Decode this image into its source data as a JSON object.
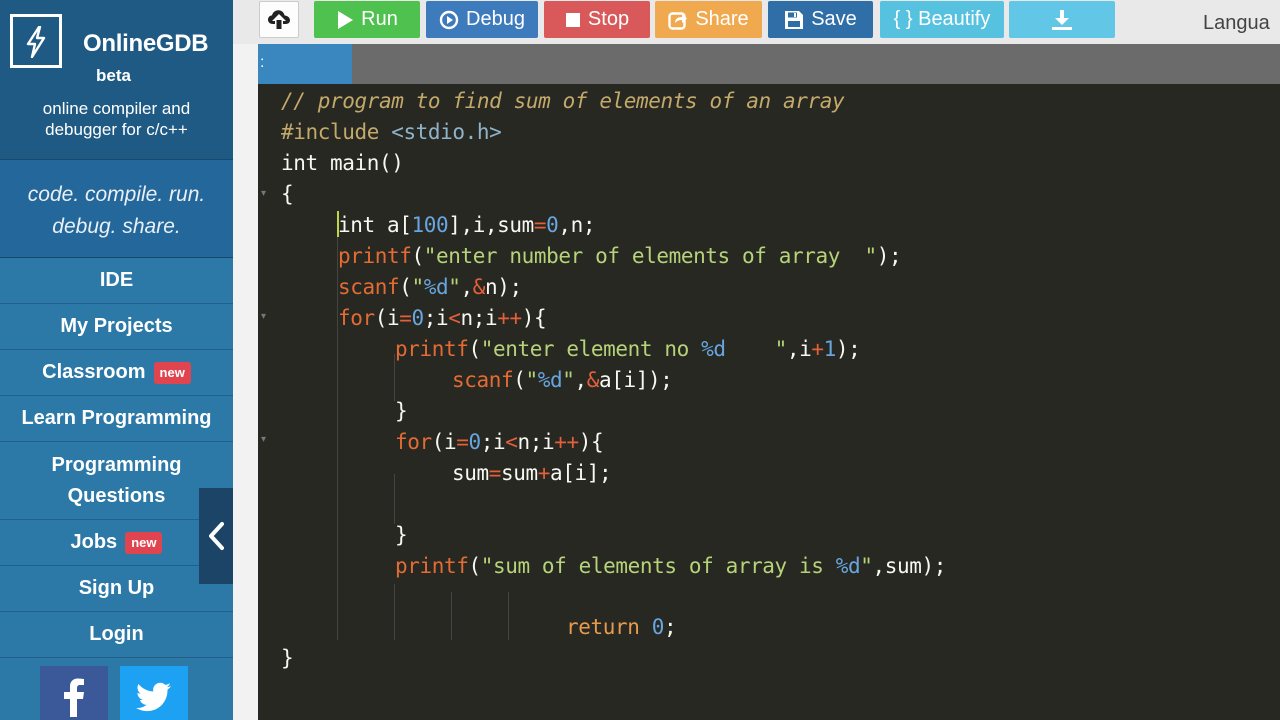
{
  "brand": {
    "name": "OnlineGDB",
    "beta": "beta",
    "subtitle_line1": "online compiler and",
    "subtitle_line2": "debugger for c/c++",
    "tagline_line1": "code. compile. run.",
    "tagline_line2": "debug. share."
  },
  "nav": {
    "ide": "IDE",
    "my_projects": "My Projects",
    "classroom": "Classroom",
    "classroom_badge": "new",
    "learn_programming": "Learn Programming",
    "programming_questions_line1": "Programming",
    "programming_questions_line2": "Questions",
    "jobs": "Jobs",
    "jobs_badge": "new",
    "sign_up": "Sign Up",
    "login": "Login"
  },
  "toolbar": {
    "run": "Run",
    "debug": "Debug",
    "stop": "Stop",
    "share": "Share",
    "save": "Save",
    "beautify": "{ } Beautify",
    "language_label": "Langua"
  },
  "tabs": {
    "active_tab": ":"
  },
  "code": {
    "l1": "// program to find sum of elements of an array",
    "l2_pre": "#include",
    "l2_hdr": " <stdio.h>",
    "l3": "int main()",
    "l4": "{",
    "l5_a": "int a[",
    "l5_num": "100",
    "l5_b": "],i,sum",
    "l5_eq": "=",
    "l5_zero": "0",
    "l5_c": ",n;",
    "l6_fn": "printf",
    "l6_a": "(",
    "l6_str": "\"enter number of elements of array  \"",
    "l6_b": ");",
    "l7_fn": "scanf",
    "l7_a": "(",
    "l7_q1": "\"",
    "l7_fmt": "%d",
    "l7_q2": "\"",
    "l7_b": ",",
    "l7_amp": "&",
    "l7_c": "n);",
    "l8_fn": "for",
    "l8_a": "(i",
    "l8_eq": "=",
    "l8_zero": "0",
    "l8_b": ";i",
    "l8_lt": "<",
    "l8_c": "n;i",
    "l8_inc": "++",
    "l8_d": "){",
    "l9_fn": "printf",
    "l9_a": "(",
    "l9_str": "\"enter element no ",
    "l9_fmt": "%d",
    "l9_str2": "    \"",
    "l9_b": ",i",
    "l9_plus": "+",
    "l9_one": "1",
    "l9_c": ");",
    "l10_fn": "scanf",
    "l10_a": "(",
    "l10_q1": "\"",
    "l10_fmt": "%d",
    "l10_q2": "\"",
    "l10_b": ",",
    "l10_amp": "&",
    "l10_c": "a[i]);",
    "l11": "}",
    "l12_fn": "for",
    "l12_a": "(i",
    "l12_eq": "=",
    "l12_zero": "0",
    "l12_b": ";i",
    "l12_lt": "<",
    "l12_c": "n;i",
    "l12_inc": "++",
    "l12_d": "){",
    "l13_a": "sum",
    "l13_eq": "=",
    "l13_b": "sum",
    "l13_plus": "+",
    "l13_c": "a[i];",
    "l15": "}",
    "l16_fn": "printf",
    "l16_a": "(",
    "l16_str": "\"sum of elements of array is ",
    "l16_fmt": "%d",
    "l16_str2": "\"",
    "l16_b": ",sum);",
    "l18_ret": "return",
    "l18_sp": " ",
    "l18_zero": "0",
    "l18_semi": ";",
    "l19": "}"
  },
  "colors": {
    "sidebar": "#2c79a8",
    "run": "#4fc14f",
    "debug": "#3d7bbd",
    "stop": "#d9595a",
    "share": "#f0a94f",
    "save": "#2f6ea6",
    "beautify": "#56c2df",
    "editor_bg": "#272822"
  },
  "icons": [
    "bolt-icon",
    "upload-icon",
    "play-icon",
    "debug-icon",
    "stop-icon",
    "share-icon",
    "save-icon",
    "download-icon",
    "facebook-icon",
    "twitter-icon",
    "chevron-left-icon"
  ]
}
